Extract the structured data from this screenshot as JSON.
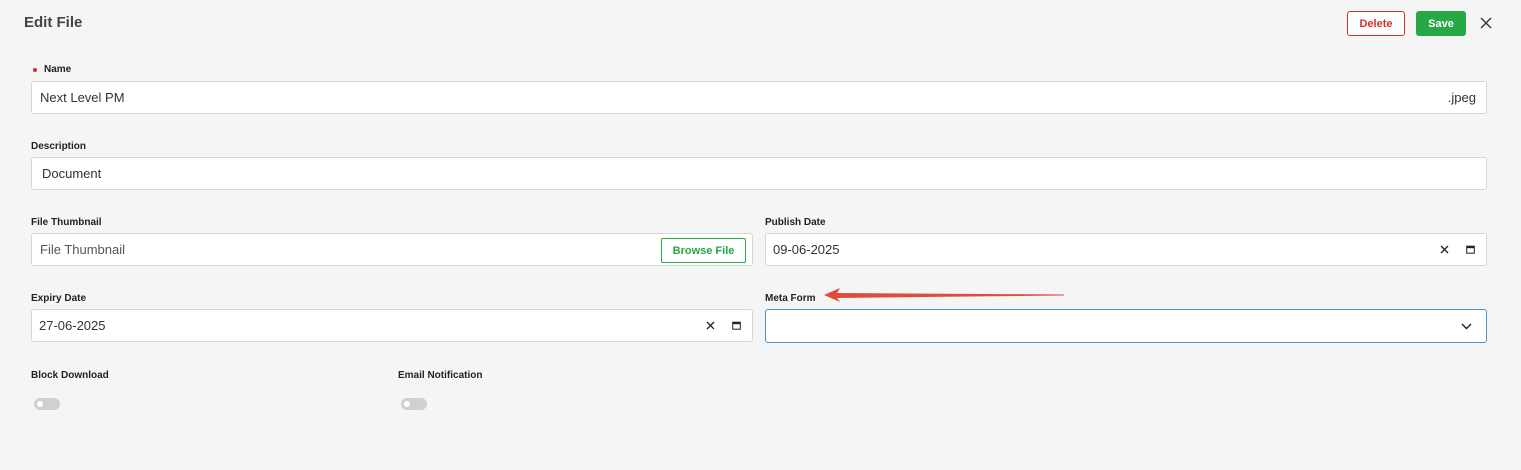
{
  "header": {
    "title": "Edit File",
    "delete_label": "Delete",
    "save_label": "Save"
  },
  "name_field": {
    "label": "Name",
    "required": true,
    "value": "Next Level PM",
    "extension": ".jpeg"
  },
  "description_field": {
    "label": "Description",
    "value": "Document"
  },
  "file_thumbnail_field": {
    "label": "File Thumbnail",
    "placeholder": "File Thumbnail",
    "browse_label": "Browse File"
  },
  "publish_date_field": {
    "label": "Publish Date",
    "value": "09-06-2025"
  },
  "expiry_date_field": {
    "label": "Expiry Date",
    "value": "27-06-2025"
  },
  "meta_form_field": {
    "label": "Meta Form",
    "value": ""
  },
  "toggles": {
    "block_download": {
      "label": "Block Download",
      "enabled": false
    },
    "email_notification": {
      "label": "Email Notification",
      "enabled": false
    }
  },
  "icons": {
    "close": "close-icon",
    "clear": "clear-icon",
    "calendar": "calendar-icon",
    "chevron": "chevron-down-icon"
  },
  "colors": {
    "delete": "#d32f2f",
    "save": "#28a745",
    "focus": "#4a90c8",
    "annotation_arrow": "#e04b3a"
  }
}
